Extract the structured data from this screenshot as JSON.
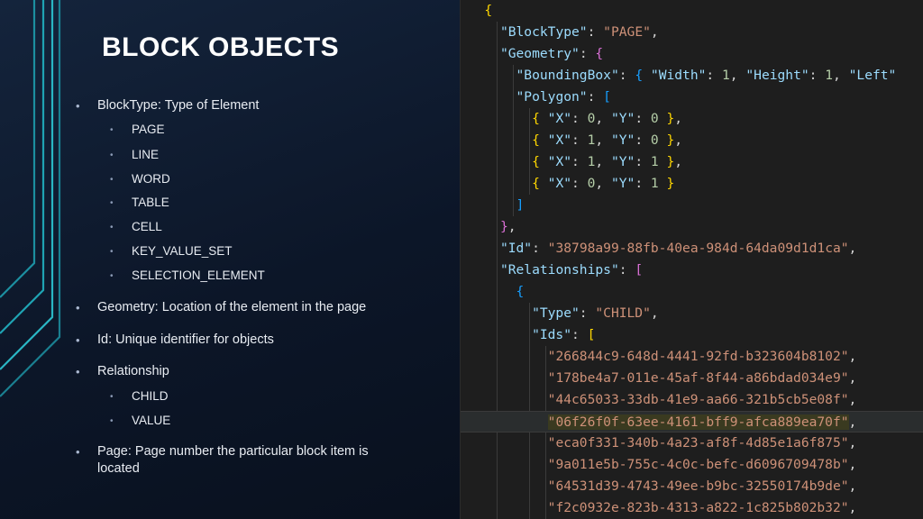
{
  "slide": {
    "title": "BLOCK OBJECTS",
    "bullets": [
      {
        "level": 1,
        "text": "BlockType: Type of Element"
      },
      {
        "level": 2,
        "text": "PAGE"
      },
      {
        "level": 2,
        "text": "LINE"
      },
      {
        "level": 2,
        "text": "WORD"
      },
      {
        "level": 2,
        "text": "TABLE"
      },
      {
        "level": 2,
        "text": "CELL"
      },
      {
        "level": 2,
        "text": "KEY_VALUE_SET"
      },
      {
        "level": 2,
        "text": "SELECTION_ELEMENT"
      },
      {
        "level": 1,
        "text": "Geometry: Location of the element in the page"
      },
      {
        "level": 1,
        "text": "Id: Unique identifier for objects"
      },
      {
        "level": 1,
        "text": "Relationship"
      },
      {
        "level": 2,
        "text": "CHILD"
      },
      {
        "level": 2,
        "text": "VALUE"
      },
      {
        "level": 1,
        "text": "Page: Page number the particular block item is located"
      }
    ]
  },
  "code": {
    "keys": {
      "blocktype": "\"BlockType\"",
      "geometry": "\"Geometry\"",
      "boundingbox": "\"BoundingBox\"",
      "width": "\"Width\"",
      "height": "\"Height\"",
      "left": "\"Left\"",
      "polygon": "\"Polygon\"",
      "x": "\"X\"",
      "y": "\"Y\"",
      "id": "\"Id\"",
      "relationships": "\"Relationships\"",
      "type": "\"Type\"",
      "ids": "\"Ids\""
    },
    "values": {
      "blocktype": "\"PAGE\"",
      "width": "1",
      "height": "1",
      "id": "\"38798a99-88fb-40ea-984d-64da09d1d1ca\"",
      "type": "\"CHILD\"",
      "polygon_points": [
        {
          "x": "0",
          "y": "0"
        },
        {
          "x": "1",
          "y": "0"
        },
        {
          "x": "1",
          "y": "1"
        },
        {
          "x": "0",
          "y": "1"
        }
      ],
      "child_ids": [
        "\"266844c9-648d-4441-92fd-b323604b8102\"",
        "\"178be4a7-011e-45af-8f44-a86bdad034e9\"",
        "\"44c65033-33db-41e9-aa66-321b5cb5e08f\"",
        "\"06f26f0f-63ee-4161-bff9-afca889ea70f\"",
        "\"eca0f331-340b-4a23-af8f-4d85e1a6f875\"",
        "\"9a011e5b-755c-4c0c-befc-d6096709478b\"",
        "\"64531d39-4743-49ee-b9bc-32550174b9de\"",
        "\"f2c0932e-823b-4313-a822-1c825b802b32\""
      ]
    },
    "highlighted_line_index": 3
  },
  "colors": {
    "background": "#0c1628",
    "accent_lines": "#1fa3b3",
    "editor_bg": "#1e1e1e",
    "key": "#9cdcfe",
    "string": "#ce9178",
    "number": "#b5cea8"
  }
}
